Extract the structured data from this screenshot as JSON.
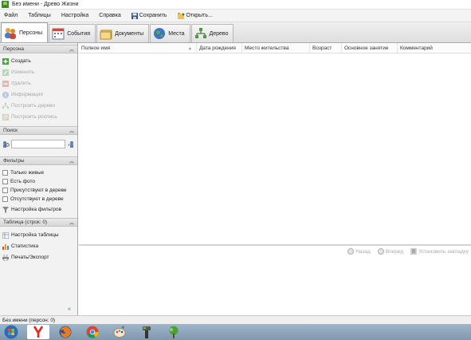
{
  "window": {
    "title": "Без имени - Древо Жизни"
  },
  "menu": {
    "file": "Файл",
    "tables": "Таблицы",
    "settings": "Настройка",
    "help": "Справка",
    "save": "Сохранить",
    "open": "Открыть..."
  },
  "tabs": [
    {
      "label": "Персоны",
      "active": true
    },
    {
      "label": "События",
      "active": false
    },
    {
      "label": "Документы",
      "active": false
    },
    {
      "label": "Места",
      "active": false
    },
    {
      "label": "Дерево",
      "active": false
    }
  ],
  "left_panel": {
    "person_section": {
      "title": "Персона",
      "items": [
        {
          "label": "Создать",
          "enabled": true
        },
        {
          "label": "Изменить",
          "enabled": false
        },
        {
          "label": "Удалить",
          "enabled": false
        },
        {
          "label": "Информация",
          "enabled": false
        },
        {
          "label": "Построить дерево",
          "enabled": false
        },
        {
          "label": "Построить роспись",
          "enabled": false
        }
      ]
    },
    "search_section": {
      "title": "Поиск",
      "value": ""
    },
    "filters_section": {
      "title": "Фильтры",
      "checkboxes": [
        {
          "label": "Только живые",
          "checked": false
        },
        {
          "label": "Есть фото",
          "checked": false
        },
        {
          "label": "Присутствуют в дереве",
          "checked": false
        },
        {
          "label": "Отсутствуют в дереве",
          "checked": false
        }
      ],
      "settings_label": "Настройка фильтров"
    },
    "table_section": {
      "title": "Таблица (строк: 0)",
      "items": [
        {
          "label": "Настройка таблицы"
        },
        {
          "label": "Статистика"
        },
        {
          "label": "Печать/Экспорт"
        }
      ]
    },
    "collapse": "«"
  },
  "grid": {
    "columns": [
      "Полное имя",
      "Дата рождения",
      "Место жительства",
      "Возраст",
      "Основное занятие",
      "Комментарий"
    ],
    "rows": []
  },
  "nav": {
    "back": "Назад",
    "forward": "Вперед",
    "bookmark": "Установить закладку"
  },
  "status": {
    "text": "Без имени (персон: 0)"
  },
  "taskbar": {
    "icons": [
      "windows-start-icon",
      "yandex-browser-icon",
      "firefox-icon",
      "chrome-icon",
      "paint-icon",
      "tool-icon",
      "family-tree-icon"
    ]
  }
}
